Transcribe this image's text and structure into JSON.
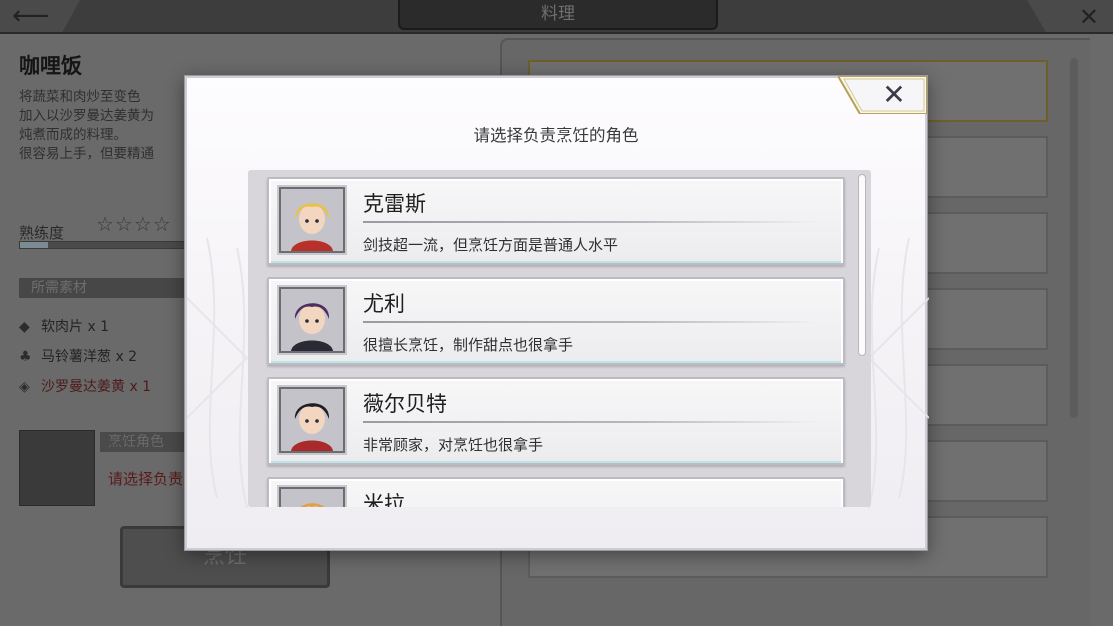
{
  "screen": {
    "title": "料理",
    "back_icon": "back-arrow-icon",
    "exit_icon": "close-x-icon"
  },
  "dish": {
    "name": "咖哩饭",
    "description_lines": [
      "将蔬菜和肉炒至变色",
      "加入以沙罗曼达姜黄为",
      "炖煮而成的料理。",
      "很容易上手，但要精通"
    ],
    "proficiency_label": "熟练度",
    "stars": "☆☆☆☆",
    "proficiency_fraction": 0.14
  },
  "materials": {
    "header": "所需素材",
    "items": [
      {
        "label": "软肉片 x 1",
        "icon": "meat-icon"
      },
      {
        "label": "马铃薯洋葱 x 2",
        "icon": "vegetable-icon"
      },
      {
        "label": "沙罗曼达姜黄 x 1",
        "icon": "spice-icon"
      }
    ]
  },
  "cook": {
    "role_label": "烹饪角色",
    "prompt": "请选择负责",
    "button_label": "烹饪"
  },
  "modal": {
    "title": "请选择负责烹饪的角色",
    "close_glyph": "✕",
    "characters": [
      {
        "name": "克雷斯",
        "desc": "剑技超一流，但烹饪方面是普通人水平",
        "hair": "#e8c248",
        "accent": "#b8302a"
      },
      {
        "name": "尤利",
        "desc": "很擅长烹饪，制作甜点也很拿手",
        "hair": "#4b2f5e",
        "accent": "#2a2a35"
      },
      {
        "name": "薇尔贝特",
        "desc": "非常顾家，对烹饪也很拿手",
        "hair": "#1e1e24",
        "accent": "#a82a2a"
      },
      {
        "name": "米拉",
        "desc": "",
        "hair": "#e0a04a",
        "accent": "#3a8a8a"
      }
    ]
  },
  "colors": {
    "modal_bg": "#f5f3f6",
    "card_bg": "#eeeef0",
    "list_bg": "#d8d6db"
  }
}
